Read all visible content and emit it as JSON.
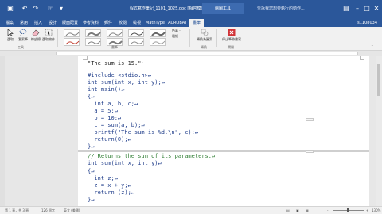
{
  "window": {
    "title": "程式寫作筆記_1101_1025.doc [相容模式] - Word",
    "tools_tab": "繪圖工具",
    "tell_me": "告訴我您想要執行的動作..."
  },
  "quick_access": {
    "save_icon": "save-icon",
    "undo_icon": "undo-icon",
    "redo_icon": "redo-icon",
    "touch_icon": "touch-mode-icon",
    "more_icon": "customize-icon"
  },
  "menu": {
    "tabs": [
      "檔案",
      "常用",
      "插入",
      "設計",
      "版面配置",
      "參考資料",
      "郵件",
      "校閱",
      "檢視",
      "MathType",
      "ACROBAT",
      "畫筆"
    ],
    "active_index": 11,
    "user": "s1108034"
  },
  "ribbon": {
    "tools": [
      {
        "label": "選取",
        "icon": "select-icon"
      },
      {
        "label": "套索筆",
        "icon": "lasso-icon"
      },
      {
        "label": "橡皮擦",
        "icon": "eraser-icon"
      },
      {
        "label": "選取物件",
        "icon": "select-objects-icon"
      }
    ],
    "tools_group": "工具",
    "pens_group": "畫筆",
    "pen_options": [
      "色彩 -",
      "粗細 -"
    ],
    "convert": {
      "label": "轉換為圖案",
      "icon": "convert-shape-icon"
    },
    "convert_group": "轉換",
    "stop": {
      "label": "停止筆跡書寫",
      "icon": "stop-ink-icon"
    },
    "close_group": "關閉"
  },
  "colors": {
    "accent": "#2b579a",
    "code_blue": "#1f3d8a",
    "comment_green": "#2e7d32",
    "stop_red": "#d13438"
  },
  "document": {
    "page1_lines": [
      {
        "text": "\"The sum is 15.\"·",
        "kind": "heading"
      },
      {
        "text": "#include <stdio.h>↵",
        "kind": "code"
      },
      {
        "text": "int sum(int x, int y);↵",
        "kind": "code"
      },
      {
        "text": "int main()↵",
        "kind": "code"
      },
      {
        "text": "{↵",
        "kind": "code"
      },
      {
        "text": "  int a, b, c;↵",
        "kind": "code"
      },
      {
        "text": "  a = 5;↵",
        "kind": "code"
      },
      {
        "text": "  b = 10;↵",
        "kind": "code"
      },
      {
        "text": "  c = sum(a, b);↵",
        "kind": "code"
      },
      {
        "text": "  printf(\"The sum is %d.\\n\", c);↵",
        "kind": "code"
      },
      {
        "text": "  return(0);↵",
        "kind": "code"
      },
      {
        "text": "}↵",
        "kind": "code"
      }
    ],
    "page2_lines": [
      {
        "text": "// Returns the sum of its parameters.↵",
        "kind": "comment"
      },
      {
        "text": "int sum(int x, int y)↵",
        "kind": "code"
      },
      {
        "text": "{↵",
        "kind": "code"
      },
      {
        "text": "  int z;↵",
        "kind": "code"
      },
      {
        "text": "  z = x + y;↵",
        "kind": "code"
      },
      {
        "text": "  return (z);↵",
        "kind": "code"
      },
      {
        "text": "}↵",
        "kind": "code"
      }
    ]
  },
  "status": {
    "page": "第 1 頁，共 3 頁",
    "words": "126 個字",
    "language": "英文 (美國)",
    "zoom": "130%",
    "zoom_minus": "-",
    "zoom_plus": "+"
  }
}
